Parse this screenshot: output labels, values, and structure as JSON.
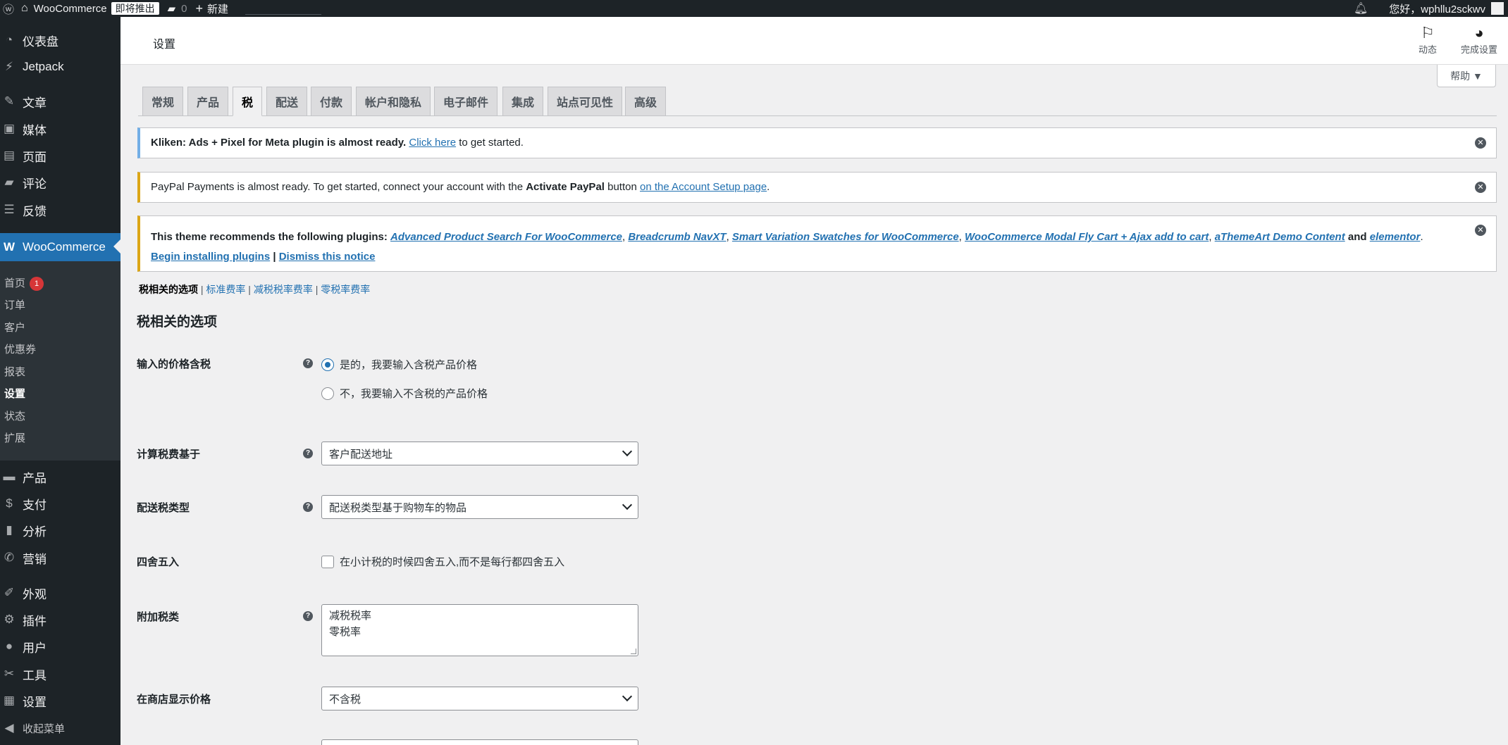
{
  "adminbar": {
    "site_name": "WooCommerce",
    "coming_soon": "即将推出",
    "comments_count": "0",
    "new_label": "新建",
    "greeting": "您好，wphllu2sckwv"
  },
  "sidebar": {
    "items": [
      {
        "label": "仪表盘",
        "icon": "dashboard-icon",
        "glyph": "◔"
      },
      {
        "label": "Jetpack",
        "icon": "jetpack-icon",
        "glyph": "⚡"
      },
      {
        "label": "文章",
        "icon": "pin-icon",
        "glyph": "✎"
      },
      {
        "label": "媒体",
        "icon": "media-icon",
        "glyph": "▣"
      },
      {
        "label": "页面",
        "icon": "page-icon",
        "glyph": "▤"
      },
      {
        "label": "评论",
        "icon": "comment-icon",
        "glyph": "▰"
      },
      {
        "label": "反馈",
        "icon": "feedback-icon",
        "glyph": "☰"
      },
      {
        "label": "WooCommerce",
        "icon": "woocommerce-icon",
        "glyph": "W"
      },
      {
        "label": "产品",
        "icon": "product-icon",
        "glyph": "▬"
      },
      {
        "label": "支付",
        "icon": "payment-icon",
        "glyph": "$"
      },
      {
        "label": "分析",
        "icon": "analytics-icon",
        "glyph": "▮"
      },
      {
        "label": "营销",
        "icon": "marketing-icon",
        "glyph": "✆"
      },
      {
        "label": "外观",
        "icon": "brush-icon",
        "glyph": "✐"
      },
      {
        "label": "插件",
        "icon": "plugin-icon",
        "glyph": "⚙"
      },
      {
        "label": "用户",
        "icon": "user-icon",
        "glyph": "●"
      },
      {
        "label": "工具",
        "icon": "wrench-icon",
        "glyph": "✂"
      },
      {
        "label": "设置",
        "icon": "settings-icon",
        "glyph": "▦"
      },
      {
        "label": "收起菜单",
        "icon": "collapse-icon",
        "glyph": "◀"
      }
    ],
    "submenu": [
      {
        "label": "首页",
        "badge": "1"
      },
      {
        "label": "订单"
      },
      {
        "label": "客户"
      },
      {
        "label": "优惠券"
      },
      {
        "label": "报表"
      },
      {
        "label": "设置"
      },
      {
        "label": "状态"
      },
      {
        "label": "扩展"
      }
    ]
  },
  "header": {
    "title": "设置",
    "activity_label": "动态",
    "finish_setup_label": "完成设置",
    "help_label": "帮助 ▼"
  },
  "tabs": [
    "常规",
    "产品",
    "税",
    "配送",
    "付款",
    "帐户和隐私",
    "电子邮件",
    "集成",
    "站点可见性",
    "高级"
  ],
  "notices": {
    "kliken": {
      "bold": "Kliken: Ads + Pixel for Meta plugin is almost ready.",
      "link": "Click here",
      "rest": "to get started."
    },
    "paypal": {
      "text1": "PayPal Payments is almost ready. To get started, connect your account with the",
      "bold": "Activate PayPal",
      "text2": "button",
      "link": "on the Account Setup page",
      "text3": "."
    },
    "theme": {
      "bold": "This theme recommends the following plugins:",
      "plugins": [
        "Advanced Product Search For WooCommerce",
        "Breadcrumb NavXT",
        "Smart Variation Swatches for WooCommerce",
        "WooCommerce Modal Fly Cart + Ajax add to cart",
        "aThemeArt Demo Content",
        "elementor"
      ],
      "and": "and",
      "install_link": "Begin installing plugins",
      "dismiss_link": "Dismiss this notice"
    }
  },
  "subnav": {
    "current": "税相关的选项",
    "links": [
      "标准费率",
      "减税税率费率",
      "零税率费率"
    ]
  },
  "section_title": "税相关的选项",
  "form": {
    "prices_incl_tax": {
      "label": "输入的价格含税",
      "option_yes": "是的，我要输入含税产品价格",
      "option_no": "不，我要输入不含税的产品价格"
    },
    "tax_based_on": {
      "label": "计算税费基于",
      "value": "客户配送地址"
    },
    "shipping_tax_class": {
      "label": "配送税类型",
      "value": "配送税类型基于购物车的物品"
    },
    "rounding": {
      "label": "四舍五入",
      "checkbox_label": "在小计税的时候四舍五入,而不是每行都四舍五入"
    },
    "additional_tax_classes": {
      "label": "附加税类",
      "lines": [
        "减税税率",
        "零税率"
      ]
    },
    "display_prices_shop": {
      "label": "在商店显示价格",
      "value": "不含税"
    }
  },
  "colors": {
    "admin_dark": "#1d2327",
    "accent_blue": "#2271b1",
    "warning_yellow": "#dba617",
    "badge_red": "#d63638"
  }
}
